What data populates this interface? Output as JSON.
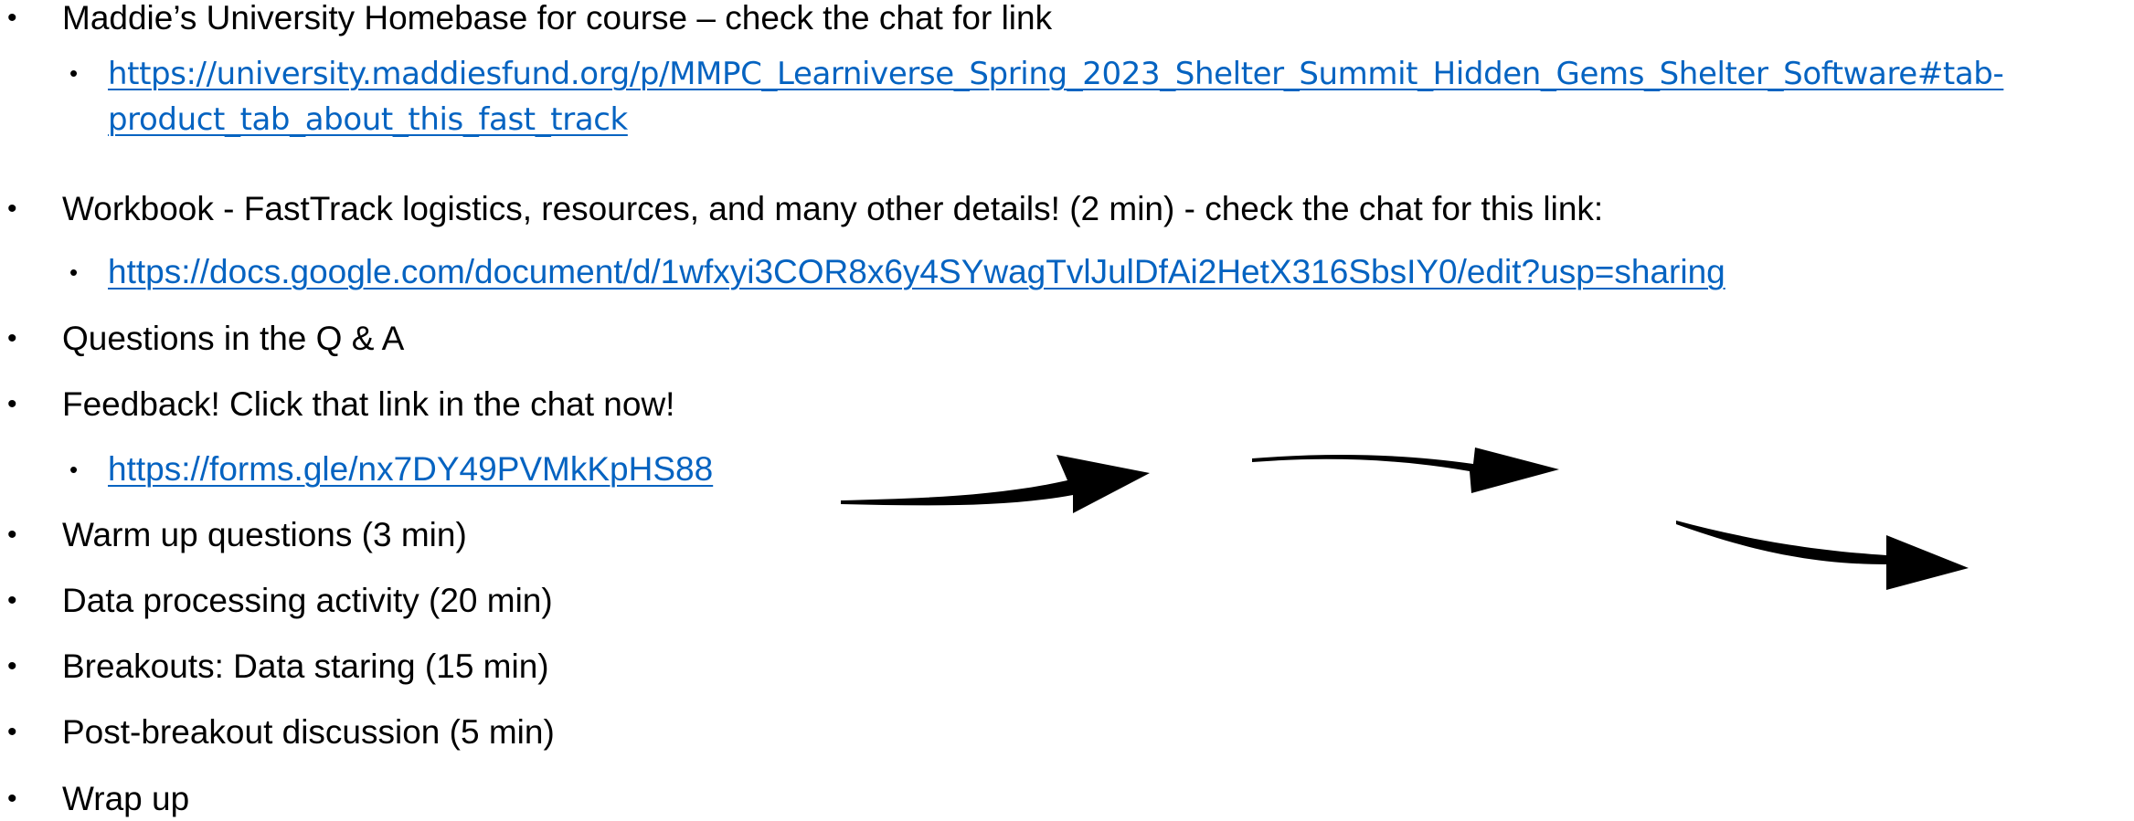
{
  "agenda": {
    "items": [
      {
        "text": "Maddie’s University Homebase for course – check the chat for link"
      },
      {
        "link_line1": "https://university.maddiesfund.org/p/MMPC_Learniverse_Spring_2023_Shelter_Summit_Hidden_Gems_Shelter_Software#tab-",
        "link_line2": "product_tab_about_this_fast_track"
      },
      {
        "text": "Workbook - FastTrack logistics, resources, and many other details! (2 min)  - check the chat for this link:"
      },
      {
        "link": "https://docs.google.com/document/d/1wfxyi3COR8x6y4SYwagTvlJulDfAi2HetX316SbsIY0/edit?usp=sharing"
      },
      {
        "text": "Questions in the Q & A"
      },
      {
        "text": "Feedback! Click that link in the chat now!"
      },
      {
        "link": "https://forms.gle/nx7DY49PVMkKpHS88"
      },
      {
        "text": "Warm up questions (3 min)"
      },
      {
        "text": "Data processing activity (20 min)"
      },
      {
        "text": "Breakouts: Data staring (15 min)"
      },
      {
        "text": "Post-breakout discussion (5 min)"
      },
      {
        "text": "Wrap up"
      }
    ],
    "bullet_glyph": "•"
  },
  "colors": {
    "text": "#000000",
    "link": "#0563c1",
    "arrow": "#000000"
  },
  "icons": [
    "curved-arrow-icon",
    "curved-arrow-icon",
    "curved-arrow-icon"
  ]
}
